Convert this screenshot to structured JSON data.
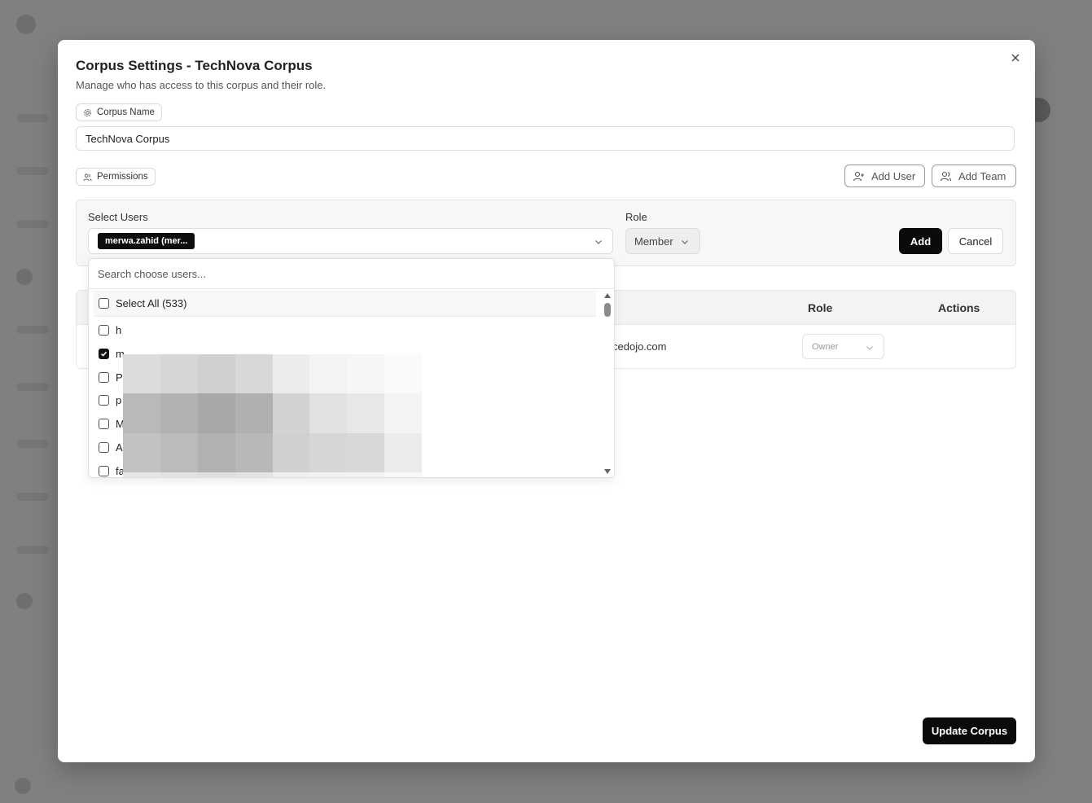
{
  "dialog": {
    "title": "Corpus Settings - TechNova Corpus",
    "subtitle": "Manage who has access to this corpus and their role.",
    "close_icon": "close-icon"
  },
  "corpus_name": {
    "label": "Corpus Name",
    "icon": "gear-icon",
    "value": "TechNova Corpus"
  },
  "permissions": {
    "label": "Permissions",
    "icon": "users-icon",
    "add_user_label": "Add User",
    "add_team_label": "Add Team"
  },
  "selector": {
    "users_label": "Select Users",
    "selected_tag": "merwa.zahid (mer...",
    "role_label": "Role",
    "role_value": "Member",
    "add_label": "Add",
    "cancel_label": "Cancel"
  },
  "dropdown": {
    "search_placeholder": "Search choose users...",
    "select_all_label": "Select All (533)",
    "items": [
      {
        "text": "h",
        "checked": false
      },
      {
        "text": "m",
        "checked": true
      },
      {
        "text": "P",
        "checked": false
      },
      {
        "text": "p",
        "checked": false
      },
      {
        "text": "M",
        "checked": false
      },
      {
        "text": "A",
        "checked": false
      },
      {
        "text": "fa",
        "checked": false
      }
    ]
  },
  "table": {
    "columns": {
      "role": "Role",
      "actions": "Actions"
    },
    "rows": [
      {
        "email_fragment": "cedojo.com",
        "role": "Owner"
      }
    ]
  },
  "footer": {
    "update_label": "Update Corpus"
  },
  "colors": {
    "primary": "#0b0b0b",
    "overlay": "#808080"
  }
}
